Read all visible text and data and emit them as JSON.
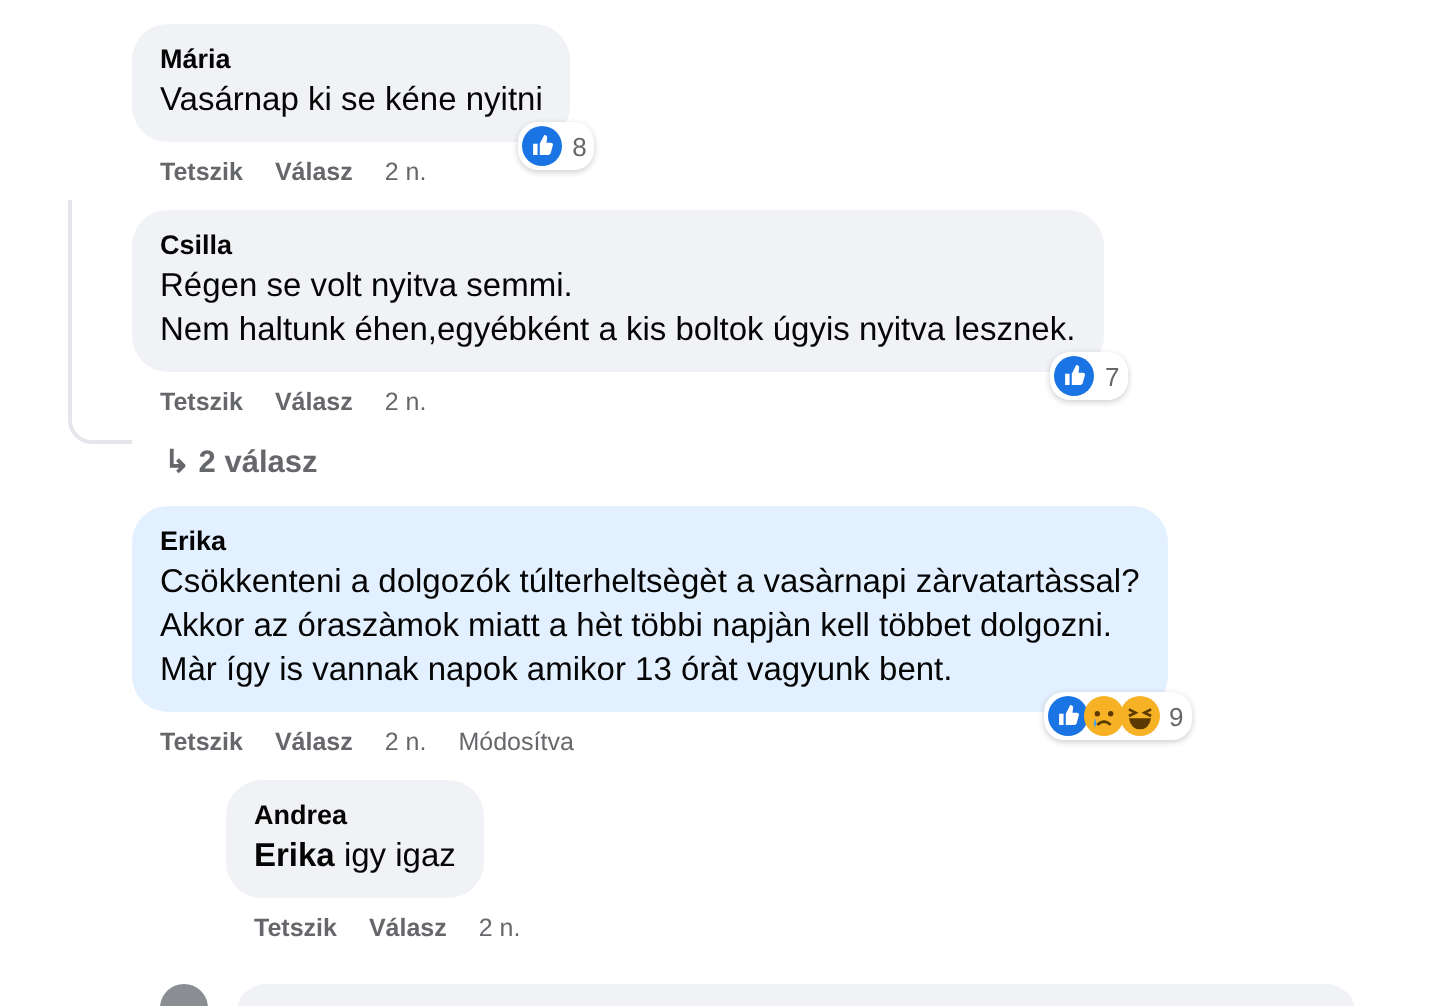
{
  "comments": [
    {
      "author": "Mária",
      "text": "Vasárnap ki se kéne nyitni",
      "highlighted": false,
      "reactions": [
        {
          "kind": "like"
        }
      ],
      "reaction_count": "8",
      "actions": [
        "Tetszik",
        "Válasz",
        "2 n."
      ]
    },
    {
      "author": "Csilla",
      "text": "Régen se volt nyitva semmi.\nNem haltunk éhen,egyébként a kis boltok úgyis nyitva lesznek.",
      "highlighted": false,
      "reactions": [
        {
          "kind": "like"
        }
      ],
      "reaction_count": "7",
      "actions": [
        "Tetszik",
        "Válasz",
        "2 n."
      ],
      "replies_link": {
        "icon": "↳",
        "label": "2 válasz"
      }
    },
    {
      "author": "Erika",
      "text": "Csökkenteni a dolgozók túlterheltsègèt a vasàrnapi zàrvatartàssal?\nAkkor az óraszàmok miatt a hèt többi napjàn kell többet dolgozni.\nMàr így is vannak napok amikor 13 óràt vagyunk bent.",
      "highlighted": true,
      "reactions": [
        {
          "kind": "like"
        },
        {
          "kind": "sad"
        },
        {
          "kind": "haha"
        }
      ],
      "reaction_count": "9",
      "actions": [
        "Tetszik",
        "Válasz",
        "2 n.",
        "Módosítva"
      ],
      "children": [
        {
          "author": "Andrea",
          "text": "**Erika** igy igaz",
          "highlighted": false,
          "actions": [
            "Tetszik",
            "Válasz",
            "2 n."
          ]
        }
      ]
    }
  ]
}
